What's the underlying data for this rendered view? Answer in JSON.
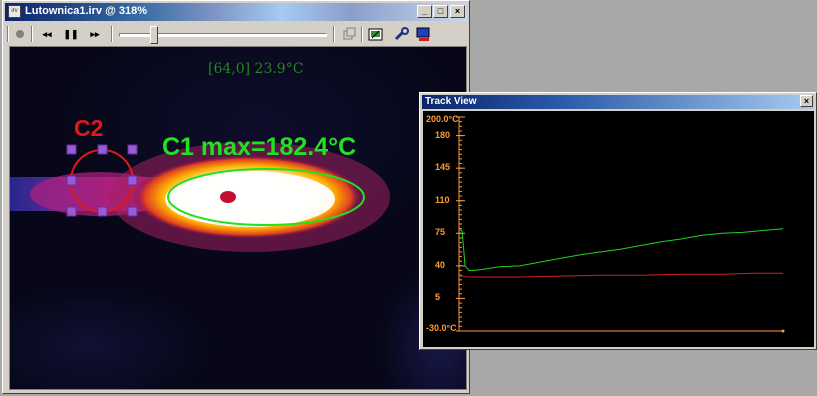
{
  "main_window": {
    "title": "Lutownica1.irv @ 318%",
    "icon": "irv-file-icon",
    "caption_buttons": {
      "minimize": "_",
      "maximize": "□",
      "close": "×"
    }
  },
  "toolbar": {
    "record_icon": "record-icon",
    "rewind_label": "◂◂",
    "pause_label": "❚❚",
    "forward_label": "▸▸",
    "slider_value": 0.19,
    "icons": [
      "copy-frame-icon",
      "export-icon",
      "tools-icon",
      "settings-icon"
    ]
  },
  "thermal": {
    "cursor_readout": "[64,0] 23.9°C",
    "c1_label": "C1 max=182.4°C",
    "c2_label": "C2",
    "c1_color": "#22e022",
    "c2_color": "#e01818",
    "handle_color": "#9a5ad8"
  },
  "track_view": {
    "title": "Track View",
    "close_label": "×",
    "chart_data": {
      "type": "line",
      "ylim": [
        -30,
        200
      ],
      "y_tick_labels": [
        {
          "value": 200,
          "label": "200.0°C"
        },
        {
          "value": 180,
          "label": "180"
        },
        {
          "value": 145,
          "label": "145"
        },
        {
          "value": 110,
          "label": "110"
        },
        {
          "value": 75,
          "label": "75"
        },
        {
          "value": 40,
          "label": "40"
        },
        {
          "value": 5,
          "label": "5"
        },
        {
          "value": -30,
          "label": "-30.0°C"
        }
      ],
      "series": [
        {
          "color": "#22d022",
          "values": [
            [
              0,
              79
            ],
            [
              3,
              78
            ],
            [
              6,
              40
            ],
            [
              10,
              35
            ],
            [
              14,
              35
            ],
            [
              22,
              36
            ],
            [
              40,
              39
            ],
            [
              60,
              40
            ],
            [
              80,
              44
            ],
            [
              100,
              48
            ],
            [
              120,
              52
            ],
            [
              140,
              55
            ],
            [
              160,
              58
            ],
            [
              180,
              62
            ],
            [
              200,
              66
            ],
            [
              220,
              69
            ],
            [
              240,
              73
            ],
            [
              260,
              75
            ],
            [
              280,
              76
            ],
            [
              300,
              78
            ],
            [
              320,
              80
            ]
          ]
        },
        {
          "color": "#d02020",
          "values": [
            [
              0,
              29
            ],
            [
              4,
              29
            ],
            [
              8,
              28
            ],
            [
              30,
              28
            ],
            [
              60,
              28
            ],
            [
              100,
              29
            ],
            [
              140,
              30
            ],
            [
              180,
              30
            ],
            [
              220,
              31
            ],
            [
              260,
              31
            ],
            [
              290,
              32
            ],
            [
              320,
              32
            ]
          ]
        }
      ],
      "axis_color": "#ff9a3a"
    }
  }
}
